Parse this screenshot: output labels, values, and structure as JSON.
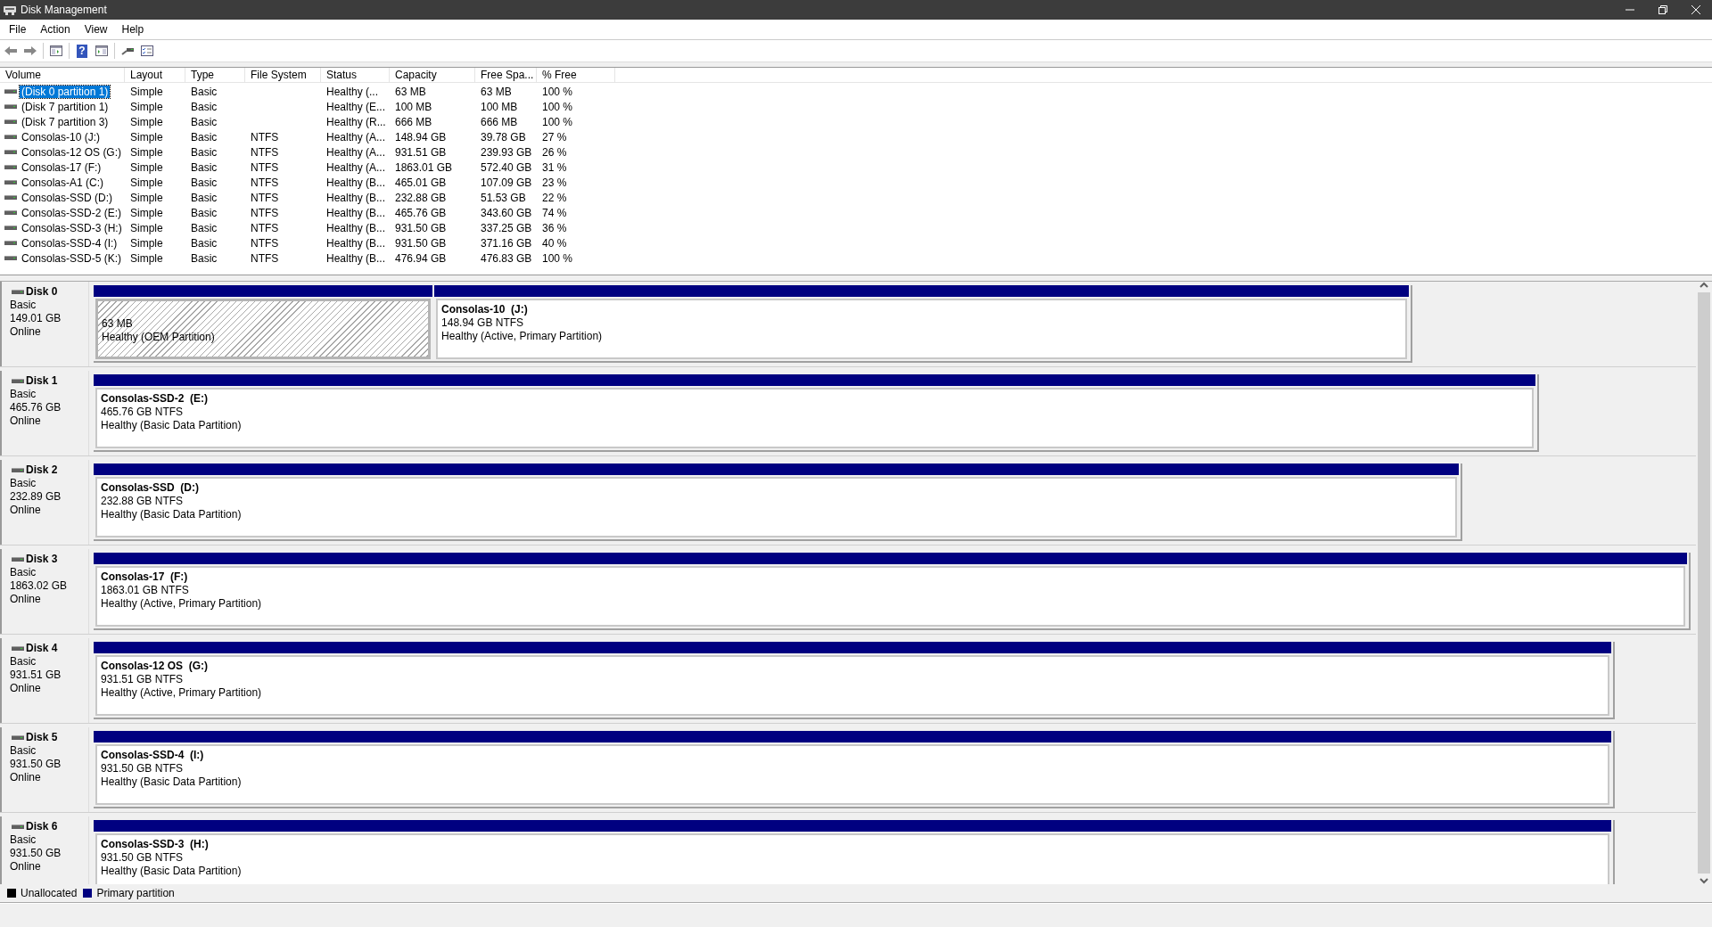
{
  "window": {
    "title": "Disk Management"
  },
  "menu": [
    "File",
    "Action",
    "View",
    "Help"
  ],
  "toolbar": {
    "help_glyph": "?"
  },
  "volumes": {
    "columns": [
      "Volume",
      "Layout",
      "Type",
      "File System",
      "Status",
      "Capacity",
      "Free Spa...",
      "% Free"
    ],
    "rows": [
      {
        "selected": true,
        "cells": [
          "(Disk 0 partition 1)",
          "Simple",
          "Basic",
          "",
          "Healthy (...",
          "63 MB",
          "63 MB",
          "100 %"
        ]
      },
      {
        "selected": false,
        "cells": [
          "(Disk 7 partition 1)",
          "Simple",
          "Basic",
          "",
          "Healthy (E...",
          "100 MB",
          "100 MB",
          "100 %"
        ]
      },
      {
        "selected": false,
        "cells": [
          "(Disk 7 partition 3)",
          "Simple",
          "Basic",
          "",
          "Healthy (R...",
          "666 MB",
          "666 MB",
          "100 %"
        ]
      },
      {
        "selected": false,
        "cells": [
          "Consolas-10 (J:)",
          "Simple",
          "Basic",
          "NTFS",
          "Healthy (A...",
          "148.94 GB",
          "39.78 GB",
          "27 %"
        ]
      },
      {
        "selected": false,
        "cells": [
          "Consolas-12 OS (G:)",
          "Simple",
          "Basic",
          "NTFS",
          "Healthy (A...",
          "931.51 GB",
          "239.93 GB",
          "26 %"
        ]
      },
      {
        "selected": false,
        "cells": [
          "Consolas-17 (F:)",
          "Simple",
          "Basic",
          "NTFS",
          "Healthy (A...",
          "1863.01 GB",
          "572.40 GB",
          "31 %"
        ]
      },
      {
        "selected": false,
        "cells": [
          "Consolas-A1 (C:)",
          "Simple",
          "Basic",
          "NTFS",
          "Healthy (B...",
          "465.01 GB",
          "107.09 GB",
          "23 %"
        ]
      },
      {
        "selected": false,
        "cells": [
          "Consolas-SSD (D:)",
          "Simple",
          "Basic",
          "NTFS",
          "Healthy (B...",
          "232.88 GB",
          "51.53 GB",
          "22 %"
        ]
      },
      {
        "selected": false,
        "cells": [
          "Consolas-SSD-2 (E:)",
          "Simple",
          "Basic",
          "NTFS",
          "Healthy (B...",
          "465.76 GB",
          "343.60 GB",
          "74 %"
        ]
      },
      {
        "selected": false,
        "cells": [
          "Consolas-SSD-3 (H:)",
          "Simple",
          "Basic",
          "NTFS",
          "Healthy (B...",
          "931.50 GB",
          "337.25 GB",
          "36 %"
        ]
      },
      {
        "selected": false,
        "cells": [
          "Consolas-SSD-4 (I:)",
          "Simple",
          "Basic",
          "NTFS",
          "Healthy (B...",
          "931.50 GB",
          "371.16 GB",
          "40 %"
        ]
      },
      {
        "selected": false,
        "cells": [
          "Consolas-SSD-5 (K:)",
          "Simple",
          "Basic",
          "NTFS",
          "Healthy (B...",
          "476.94 GB",
          "476.83 GB",
          "100 %"
        ]
      }
    ]
  },
  "disks": [
    {
      "name": "Disk 0",
      "type": "Basic",
      "size": "149.01 GB",
      "status": "Online",
      "partitions": [
        {
          "size": "63 MB",
          "health": "Healthy (OEM Partition)",
          "selected": true
        },
        {
          "label": "Consolas-10  (J:)",
          "size": "148.94 GB NTFS",
          "health": "Healthy (Active, Primary Partition)",
          "selected": false
        }
      ]
    },
    {
      "name": "Disk 1",
      "type": "Basic",
      "size": "465.76 GB",
      "status": "Online",
      "partitions": [
        {
          "label": "Consolas-SSD-2  (E:)",
          "size": "465.76 GB NTFS",
          "health": "Healthy (Basic Data Partition)",
          "selected": false
        }
      ]
    },
    {
      "name": "Disk 2",
      "type": "Basic",
      "size": "232.89 GB",
      "status": "Online",
      "partitions": [
        {
          "label": "Consolas-SSD  (D:)",
          "size": "232.88 GB NTFS",
          "health": "Healthy (Basic Data Partition)",
          "selected": false
        }
      ]
    },
    {
      "name": "Disk 3",
      "type": "Basic",
      "size": "1863.02 GB",
      "status": "Online",
      "partitions": [
        {
          "label": "Consolas-17  (F:)",
          "size": "1863.01 GB NTFS",
          "health": "Healthy (Active, Primary Partition)",
          "selected": false
        }
      ]
    },
    {
      "name": "Disk 4",
      "type": "Basic",
      "size": "931.51 GB",
      "status": "Online",
      "partitions": [
        {
          "label": "Consolas-12 OS  (G:)",
          "size": "931.51 GB NTFS",
          "health": "Healthy (Active, Primary Partition)",
          "selected": false
        }
      ]
    },
    {
      "name": "Disk 5",
      "type": "Basic",
      "size": "931.50 GB",
      "status": "Online",
      "partitions": [
        {
          "label": "Consolas-SSD-4  (I:)",
          "size": "931.50 GB NTFS",
          "health": "Healthy (Basic Data Partition)",
          "selected": false
        }
      ]
    },
    {
      "name": "Disk 6",
      "type": "Basic",
      "size": "931.50 GB",
      "status": "Online",
      "partitions": [
        {
          "label": "Consolas-SSD-3  (H:)",
          "size": "931.50 GB NTFS",
          "health": "Healthy (Basic Data Partition)",
          "selected": false
        }
      ]
    }
  ],
  "legend": [
    {
      "label": "Unallocated",
      "color": "#000000"
    },
    {
      "label": "Primary partition",
      "color": "#000080"
    }
  ]
}
